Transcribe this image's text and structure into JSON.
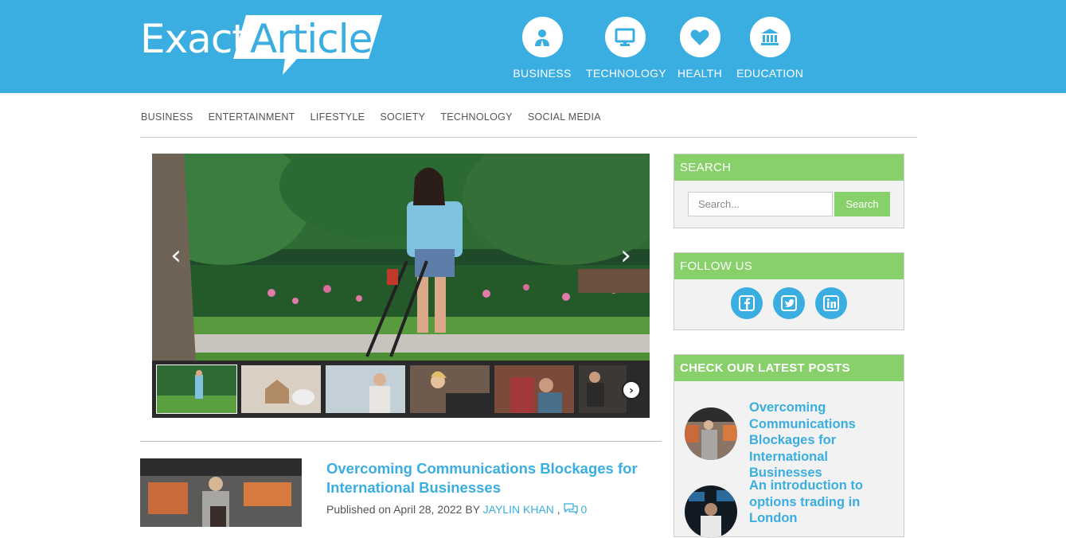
{
  "brand": {
    "logo_left": "Exact",
    "logo_right": "Article"
  },
  "top_categories": [
    {
      "label": "BUSINESS",
      "icon": "business-person-icon"
    },
    {
      "label": "TECHNOLOGY",
      "icon": "monitor-icon"
    },
    {
      "label": "HEALTH",
      "icon": "heart-icon"
    },
    {
      "label": "EDUCATION",
      "icon": "institution-icon"
    }
  ],
  "nav": {
    "items": [
      "BUSINESS",
      "ENTERTAINMENT",
      "LIFESTYLE",
      "SOCIETY",
      "TECHNOLOGY",
      "SOCIAL MEDIA"
    ]
  },
  "slider": {
    "prev_symbol": "‹",
    "next_symbol": "›",
    "thumb_next_symbol": "›",
    "thumb_count": 6
  },
  "article": {
    "title": "Overcoming Communications Blockages for International Businesses",
    "published_prefix": "Published on April 28, 2022 BY",
    "author": "JAYLIN KHAN",
    "comment_count": "0"
  },
  "sidebar": {
    "search": {
      "heading": "SEARCH",
      "placeholder": "Search...",
      "button": "Search"
    },
    "follow": {
      "heading": "FOLLOW US",
      "networks": [
        "facebook-icon",
        "twitter-icon",
        "linkedin-icon"
      ]
    },
    "latest": {
      "heading": "CHECK OUR LATEST POSTS",
      "posts": [
        {
          "title": "Overcoming Communications Blockages for International Businesses"
        },
        {
          "title": "An introduction to options trading in London"
        }
      ]
    }
  },
  "colors": {
    "brand_blue": "#3aaee0",
    "widget_green": "#88d06a"
  }
}
